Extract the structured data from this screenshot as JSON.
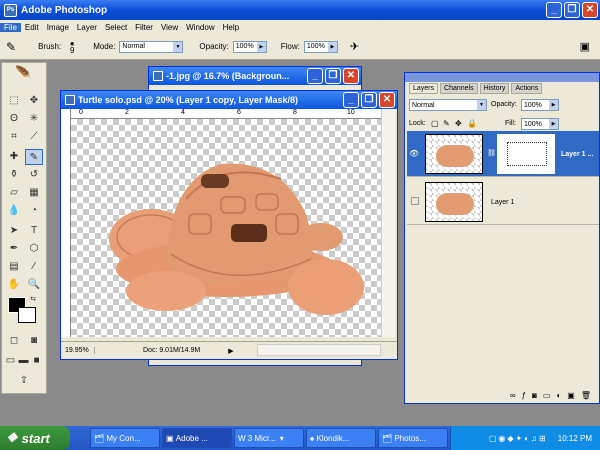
{
  "app": {
    "title": "Adobe Photoshop",
    "icon": "photoshop-icon"
  },
  "menu": [
    "File",
    "Edit",
    "Image",
    "Layer",
    "Select",
    "Filter",
    "View",
    "Window",
    "Help"
  ],
  "options": {
    "brush_label": "Brush:",
    "brush_size": "9",
    "mode_label": "Mode:",
    "mode_value": "Normal",
    "opacity_label": "Opacity:",
    "opacity_value": "100%",
    "flow_label": "Flow:",
    "flow_value": "100%"
  },
  "bg_doc": {
    "title": "-1.jpg @ 16.7% (Backgroun..."
  },
  "doc": {
    "title": "Turtle solo.psd @ 20% (Layer 1 copy, Layer Mask/8)",
    "zoom": "19.95%",
    "info": "Doc: 9.01M/14.9M",
    "ruler_ticks": [
      "0",
      "2",
      "4",
      "6",
      "8",
      "10"
    ]
  },
  "layers_panel": {
    "tabs": [
      "Layers",
      "Channels",
      "History",
      "Actions"
    ],
    "blend": "Normal",
    "opacity_label": "Opacity:",
    "opacity_value": "100%",
    "lock_label": "Lock:",
    "fill_label": "Fill:",
    "fill_value": "100%",
    "layers": [
      {
        "name": "Layer 1 ..."
      },
      {
        "name": "Layer 1"
      }
    ]
  },
  "taskbar": {
    "start": "start",
    "tasks": [
      "My Con...",
      "Adobe ...",
      "3 Micr...",
      "Klondik...",
      "Photos..."
    ],
    "time": "10:12 PM"
  },
  "colors": {
    "accent": "#0a4fd8",
    "taskbar": "#2457c5",
    "start": "#2f7d2f"
  }
}
